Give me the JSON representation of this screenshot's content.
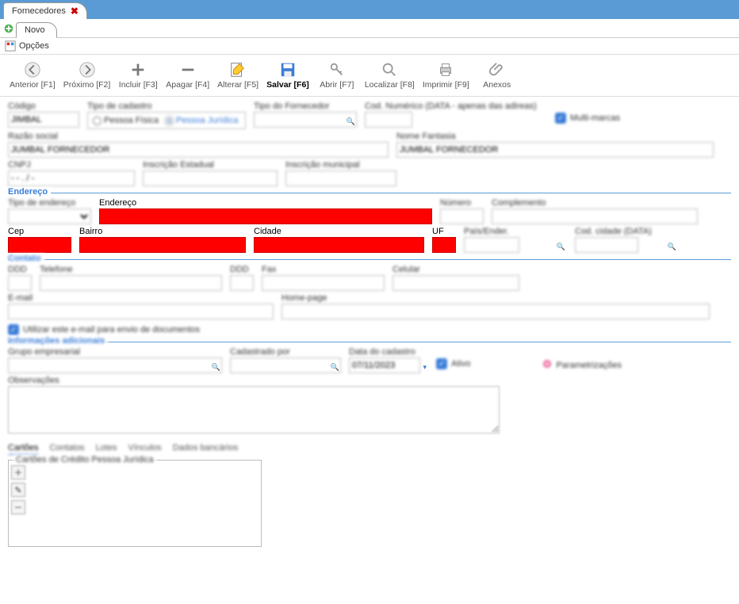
{
  "tabs": {
    "main": "Fornecedores"
  },
  "subtab": "Novo",
  "options": "Opções",
  "toolbar": {
    "anterior": "Anterior [F1]",
    "proximo": "Próximo [F2]",
    "incluir": "Incluir [F3]",
    "apagar": "Apagar [F4]",
    "alterar": "Alterar [F5]",
    "salvar": "Salvar [F6]",
    "abrir": "Abrir [F7]",
    "localizar": "Localizar [F8]",
    "imprimir": "Imprimir [F9]",
    "anexos": "Anexos"
  },
  "fields": {
    "codigo": {
      "label": "Código",
      "value": "JIMBAL"
    },
    "tipo_cadastro": {
      "label": "Tipo de cadastro",
      "pf": "Pessoa Física",
      "pj": "Pessoa Jurídica"
    },
    "tipo_fornecedor": {
      "label": "Tipo do Fornecedor"
    },
    "cod_numerico": {
      "label": "Cod. Numérico (DATA - apenas das adireas)"
    },
    "multi_marcas": "Multi-marcas",
    "razao": {
      "label": "Razão social",
      "value": "JUMBAL FORNECEDOR"
    },
    "fantasia": {
      "label": "Nome Fantasia",
      "value": "JUMBAL FORNECEDOR"
    },
    "cnpj": {
      "label": "CNPJ",
      "value": "- - . / -"
    },
    "insc_est": {
      "label": "Inscrição Estadual"
    },
    "insc_mun": {
      "label": "Inscrição municipal"
    }
  },
  "endereco": {
    "legend": "Endereço",
    "tipo": "Tipo de endereço",
    "endereco": "Endereço",
    "numero": "Número",
    "complemento": "Complemento",
    "cep": "Cep",
    "bairro": "Bairro",
    "cidade": "Cidade",
    "uf": "UF",
    "pais": "País/Ender.",
    "cod_cidade": "Cod. cidade (DATA)"
  },
  "contato": {
    "legend": "Contato",
    "ddd1": "DDD",
    "telefone": "Telefone",
    "ddd2": "DDD",
    "fax": "Fax",
    "celular": "Celular",
    "email": "E-mail",
    "homepage": "Home-page",
    "usar_email": "Utilizar este e-mail para envio de documentos"
  },
  "info": {
    "legend": "Informações adicionais",
    "grupo": "Grupo empresarial",
    "cadastrado_por": "Cadastrado por",
    "data_cadastro": {
      "label": "Data do cadastro",
      "value": "07/11/2023"
    },
    "ativo": "Ativo",
    "param": "Parametrizações",
    "obs": "Observações"
  },
  "bottom_tabs": {
    "cartoes": "Cartões",
    "contatos": "Contatos",
    "lotes": "Lotes",
    "vinculos": "Vínculos",
    "dados_bancarios": "Dados bancários"
  },
  "cards": {
    "legend": "Cartões de Crédito Pessoa Jurídica"
  }
}
